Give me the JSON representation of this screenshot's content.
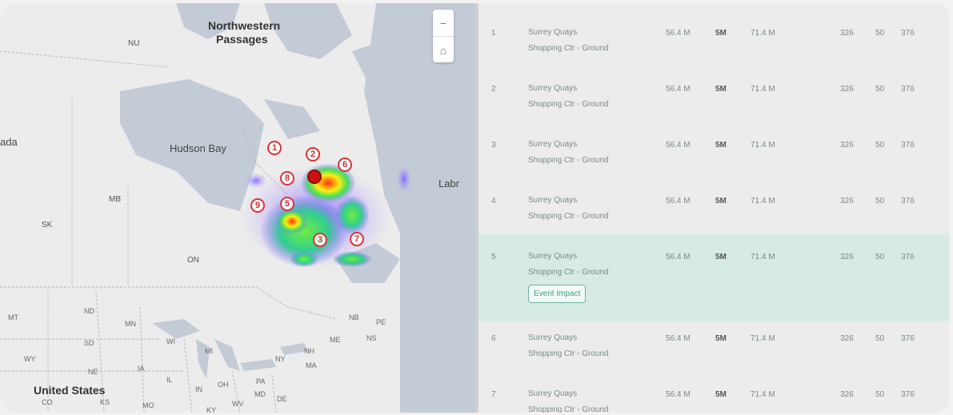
{
  "map": {
    "labels": {
      "northwestern": "Northwestern",
      "passages": "Passages",
      "nu": "NU",
      "hudson_bay": "Hudson Bay",
      "ada": "ada",
      "mb": "MB",
      "sk": "SK",
      "on": "ON",
      "labr": "Labr",
      "mt": "MT",
      "nd": "ND",
      "mn": "MN",
      "sd": "SD",
      "wy": "WY",
      "ne": "NE",
      "ia": "IA",
      "wi": "WI",
      "mi": "MI",
      "il": "IL",
      "in": "IN",
      "oh": "OH",
      "pa": "PA",
      "ny": "NY",
      "nh": "NH",
      "ma": "MA",
      "me": "ME",
      "nb": "NB",
      "pe": "PE",
      "ns": "NS",
      "md": "MD",
      "de": "DE",
      "wv": "WV",
      "ky": "KY",
      "mo": "MO",
      "ks": "KS",
      "co": "CO",
      "us": "United States"
    },
    "zoom": {
      "in": "+",
      "out": "−",
      "home": "⌂"
    },
    "markers": [
      {
        "label": "1",
        "active": false
      },
      {
        "label": "2",
        "active": false
      },
      {
        "label": "6",
        "active": false
      },
      {
        "label": "8",
        "active": false
      },
      {
        "label": "",
        "active": true
      },
      {
        "label": "9",
        "active": false
      },
      {
        "label": "5",
        "active": false
      },
      {
        "label": "3",
        "active": false
      },
      {
        "label": "7",
        "active": false
      }
    ]
  },
  "table": {
    "action_label": "Event Impact",
    "rows": [
      {
        "rank": "1",
        "name_line1": "Surrey Quays",
        "name_line2": "Shopping Ctr - Ground",
        "v1": "56.4 M",
        "v2": "5M",
        "v3": "71.4 M",
        "v4": "326",
        "v5": "50",
        "v6": "376",
        "highlight": false
      },
      {
        "rank": "2",
        "name_line1": "Surrey Quays",
        "name_line2": "Shopping Ctr - Ground",
        "v1": "56.4 M",
        "v2": "5M",
        "v3": "71.4 M",
        "v4": "326",
        "v5": "50",
        "v6": "376",
        "highlight": false
      },
      {
        "rank": "3",
        "name_line1": "Surrey Quays",
        "name_line2": "Shopping Ctr - Ground",
        "v1": "56.4 M",
        "v2": "5M",
        "v3": "71.4 M",
        "v4": "326",
        "v5": "50",
        "v6": "376",
        "highlight": false
      },
      {
        "rank": "4",
        "name_line1": "Surrey Quays",
        "name_line2": "Shopping Ctr - Ground",
        "v1": "56.4 M",
        "v2": "5M",
        "v3": "71.4 M",
        "v4": "326",
        "v5": "50",
        "v6": "376",
        "highlight": false
      },
      {
        "rank": "5",
        "name_line1": "Surrey Quays",
        "name_line2": "Shopping Ctr - Ground",
        "v1": "56.4 M",
        "v2": "5M",
        "v3": "71.4 M",
        "v4": "326",
        "v5": "50",
        "v6": "376",
        "highlight": true
      },
      {
        "rank": "6",
        "name_line1": "Surrey Quays",
        "name_line2": "Shopping Ctr - Ground",
        "v1": "56.4 M",
        "v2": "5M",
        "v3": "71.4 M",
        "v4": "326",
        "v5": "50",
        "v6": "376",
        "highlight": false
      },
      {
        "rank": "7",
        "name_line1": "Surrey Quays",
        "name_line2": "Shopping Ctr - Ground",
        "v1": "56.4 M",
        "v2": "5M",
        "v3": "71.4 M",
        "v4": "326",
        "v5": "50",
        "v6": "376",
        "highlight": false
      }
    ]
  },
  "colors": {
    "highlight_row": "#d7ebe4",
    "accent": "#4e9a86",
    "marker": "#d33333",
    "water": "#bfc8d2"
  }
}
